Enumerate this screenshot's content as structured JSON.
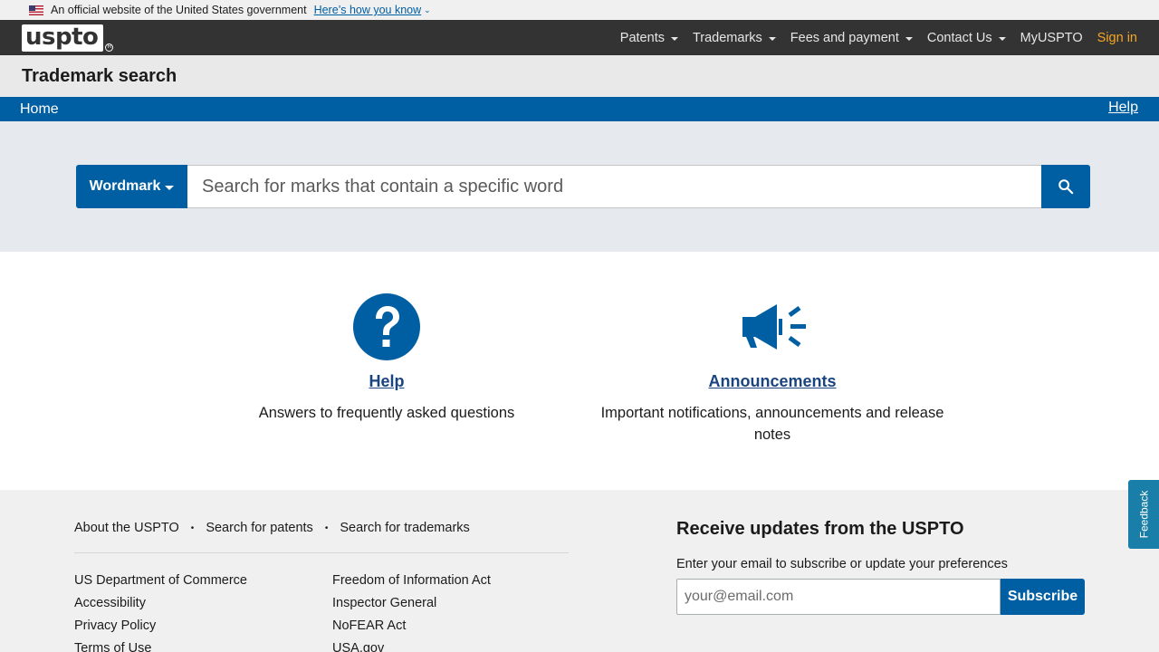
{
  "gov_banner": {
    "text": "An official website of the United States government",
    "link": "Here’s how you know"
  },
  "header": {
    "logo": "uspto",
    "nav": [
      {
        "label": "Patents"
      },
      {
        "label": "Trademarks"
      },
      {
        "label": "Fees and payment"
      },
      {
        "label": "Contact Us"
      },
      {
        "label": "MyUSPTO"
      },
      {
        "label": "Sign in"
      }
    ]
  },
  "title_bar": {
    "title": "Trademark search"
  },
  "breadcrumb": {
    "home": "Home",
    "help": "Help"
  },
  "search": {
    "select_label": "Wordmark",
    "placeholder": "Search for marks that contain a specific word",
    "button_icon": "search-icon"
  },
  "cards": {
    "help": {
      "icon": "question-circle-icon",
      "title": "Help",
      "description": "Answers to frequently asked questions"
    },
    "announcements": {
      "icon": "megaphone-icon",
      "title": "Announcements",
      "description": "Important notifications, announcements and release notes"
    }
  },
  "footer": {
    "top_links": [
      "About the USPTO",
      "Search for patents",
      "Search for trademarks"
    ],
    "col1": [
      "US Department of Commerce",
      "Accessibility",
      "Privacy Policy",
      "Terms of Use"
    ],
    "col2": [
      "Freedom of Information Act",
      "Inspector General",
      "NoFEAR Act",
      "USA.gov"
    ],
    "updates_title": "Receive updates from the USPTO",
    "updates_sub": "Enter your email to subscribe or update your preferences",
    "email_placeholder": "your@email.com",
    "subscribe_label": "Subscribe"
  },
  "feedback_label": "Feedback",
  "colors": {
    "primary": "#005ea2",
    "topnav": "#333333",
    "signin": "#f5a623",
    "feedback": "#1a7fa8"
  }
}
